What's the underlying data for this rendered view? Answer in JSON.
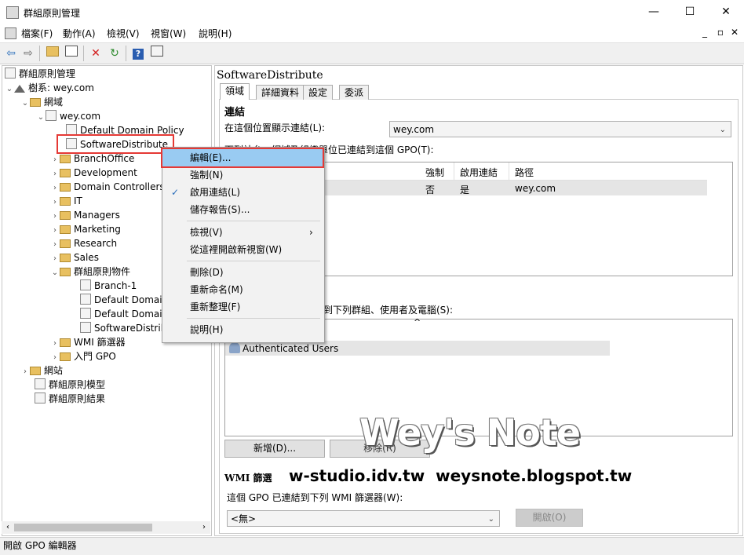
{
  "window": {
    "title": "群組原則管理",
    "minimize": "—",
    "maximize": "☐",
    "close": "✕"
  },
  "menubar": {
    "items": [
      "檔案(F)",
      "動作(A)",
      "檢視(V)",
      "視窗(W)",
      "說明(H)"
    ],
    "inner_controls": [
      "_",
      "▫",
      "✕"
    ]
  },
  "toolbar": {
    "icons": [
      "back-icon",
      "forward-icon",
      "up-folder-icon",
      "show-hide-tree-icon",
      "delete-icon",
      "refresh-icon",
      "help-icon",
      "properties-icon"
    ]
  },
  "tree": {
    "root": "群組原則管理",
    "forest": "樹系: wey.com",
    "domains": "網域",
    "domain": "wey.com",
    "default_policy": "Default Domain Policy",
    "selected_gpo": "SoftwareDistribute",
    "ous": [
      "BranchOffice",
      "Development",
      "Domain Controllers",
      "IT",
      "Managers",
      "Marketing",
      "Research",
      "Sales"
    ],
    "gpo_container": "群組原則物件",
    "gpo_objects": [
      "Branch-1",
      "Default Domain",
      "Default Domain",
      "SoftwareDistrib"
    ],
    "wmi_filters": "WMI 篩選器",
    "starter_gpo": "入門 GPO",
    "sites": "網站",
    "modeling": "群組原則模型",
    "results": "群組原則結果"
  },
  "details": {
    "header": "SoftwareDistribute",
    "tabs": [
      "領域",
      "詳細資料",
      "設定",
      "委派"
    ],
    "links_section": "連結",
    "location_label": "在這個位置顯示連結(L):",
    "location_value": "wey.com",
    "links_desc": "下列站台、網域及組織單位已連結到這個 GPO(T):",
    "links_columns": [
      "強制",
      "啟用連結",
      "路徑"
    ],
    "links_row": {
      "enforced": "否",
      "enabled": "是",
      "path": "wey.com"
    },
    "security_desc": "用到下列群組、使用者及電腦(S):",
    "security_entry": "Authenticated Users",
    "add_button": "新增(D)...",
    "remove_button": "移除(R)",
    "wmi_section": "WMI 篩選",
    "wmi_desc": "這個 GPO 已連結到下列 WMI 篩選器(W):",
    "wmi_value": "<無>",
    "open_button": "開啟(O)"
  },
  "context_menu": {
    "items": [
      {
        "label": "編輯(E)...",
        "highlighted": true
      },
      {
        "label": "強制(N)"
      },
      {
        "label": "啟用連結(L)",
        "checked": true
      },
      {
        "label": "儲存報告(S)..."
      },
      {
        "label": "檢視(V)",
        "submenu": true
      },
      {
        "label": "從這裡開啟新視窗(W)"
      },
      {
        "label": "刪除(D)"
      },
      {
        "label": "重新命名(M)"
      },
      {
        "label": "重新整理(F)"
      },
      {
        "label": "說明(H)"
      }
    ]
  },
  "watermark": {
    "title": "Wey's Note",
    "urls": "w-studio.idv.tw  weysnote.blogspot.tw"
  },
  "statusbar": {
    "text": "開啟 GPO 編輯器"
  }
}
